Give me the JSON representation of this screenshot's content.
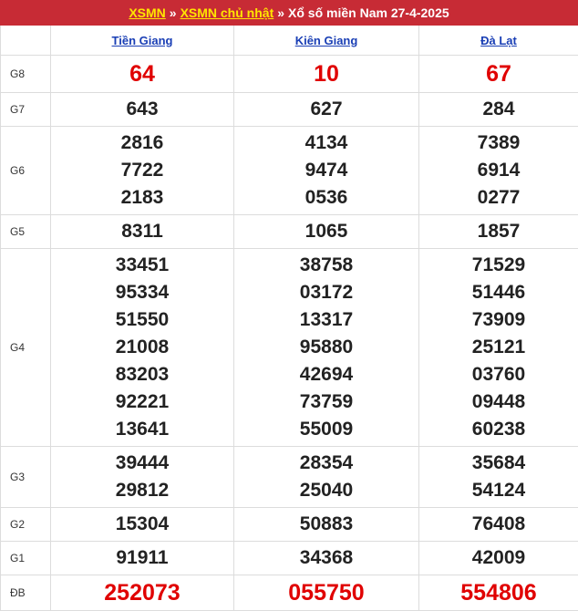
{
  "header": {
    "link1": "XSMN",
    "sep": "»",
    "link2": "XSMN chủ nhật",
    "title": "Xổ số miền Nam 27-4-2025"
  },
  "columns": [
    "Tiền Giang",
    "Kiên Giang",
    "Đà Lạt"
  ],
  "prizes": [
    {
      "label": "G8",
      "values": [
        [
          "64"
        ],
        [
          "10"
        ],
        [
          "67"
        ]
      ]
    },
    {
      "label": "G7",
      "values": [
        [
          "643"
        ],
        [
          "627"
        ],
        [
          "284"
        ]
      ]
    },
    {
      "label": "G6",
      "values": [
        [
          "2816",
          "7722",
          "2183"
        ],
        [
          "4134",
          "9474",
          "0536"
        ],
        [
          "7389",
          "6914",
          "0277"
        ]
      ]
    },
    {
      "label": "G5",
      "values": [
        [
          "8311"
        ],
        [
          "1065"
        ],
        [
          "1857"
        ]
      ]
    },
    {
      "label": "G4",
      "values": [
        [
          "33451",
          "95334",
          "51550",
          "21008",
          "83203",
          "92221",
          "13641"
        ],
        [
          "38758",
          "03172",
          "13317",
          "95880",
          "42694",
          "73759",
          "55009"
        ],
        [
          "71529",
          "51446",
          "73909",
          "25121",
          "03760",
          "09448",
          "60238"
        ]
      ]
    },
    {
      "label": "G3",
      "values": [
        [
          "39444",
          "29812"
        ],
        [
          "28354",
          "25040"
        ],
        [
          "35684",
          "54124"
        ]
      ]
    },
    {
      "label": "G2",
      "values": [
        [
          "15304"
        ],
        [
          "50883"
        ],
        [
          "76408"
        ]
      ]
    },
    {
      "label": "G1",
      "values": [
        [
          "91911"
        ],
        [
          "34368"
        ],
        [
          "42009"
        ]
      ]
    },
    {
      "label": "ĐB",
      "values": [
        [
          "252073"
        ],
        [
          "055750"
        ],
        [
          "554806"
        ]
      ]
    }
  ],
  "colors": {
    "header_bg": "#c72b35",
    "link": "#ffe500",
    "column_head": "#1a3fb5",
    "highlight": "#e00000"
  }
}
